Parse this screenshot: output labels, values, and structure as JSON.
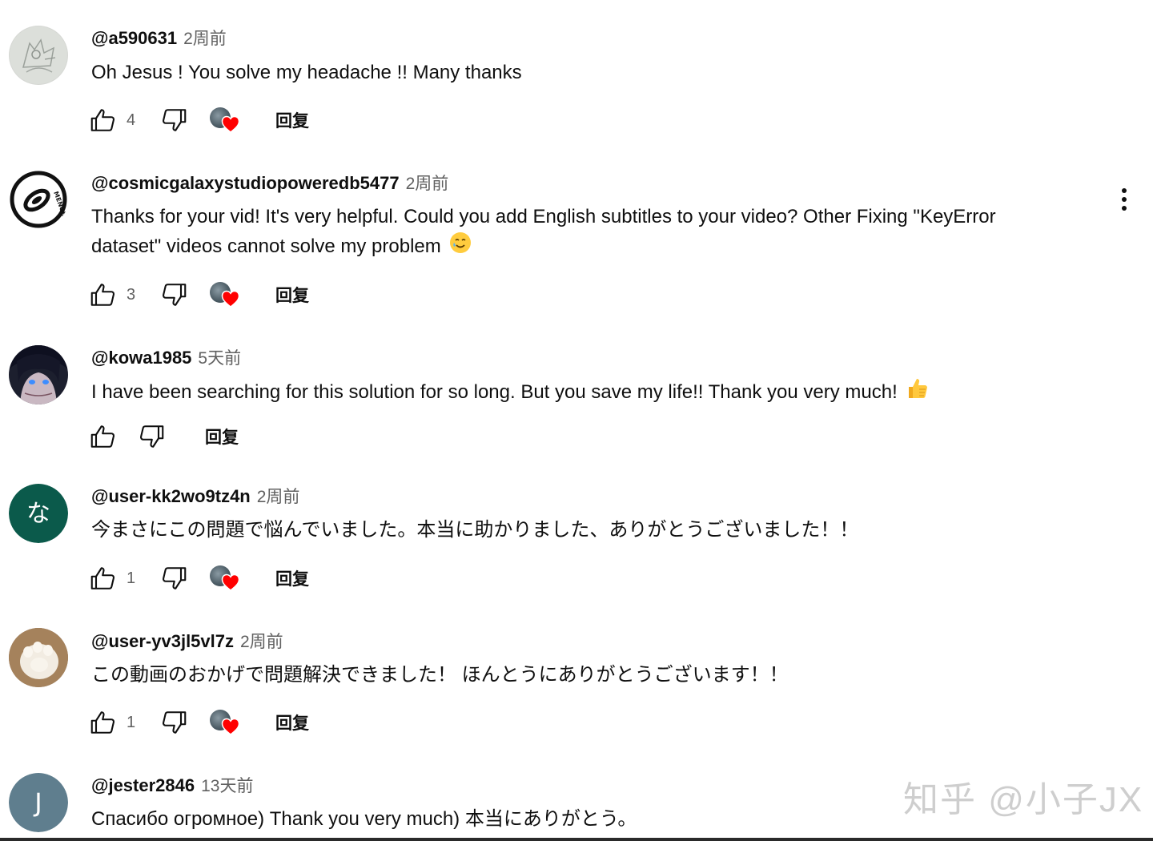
{
  "comments": [
    {
      "author": "@a590631",
      "time": "2周前",
      "text": "Oh Jesus ! You solve my headache !! Many thanks",
      "likes": "4",
      "reply_label": "回复",
      "avatar_icon": "sketch-avatar-icon",
      "creator_heart": true
    },
    {
      "author": "@cosmicgalaxystudiopoweredb5477",
      "time": "2周前",
      "text": "Thanks for your vid! It's very helpful. Could you add English subtitles to your video? Other Fixing \"KeyError dataset\" videos cannot solve my problem",
      "text_emoji": "smiling-face-with-tear-emoji",
      "likes": "3",
      "reply_label": "回复",
      "avatar_icon": "spiral-logo-avatar-icon",
      "avatar_text": "MENGEL KIU",
      "creator_heart": true,
      "has_menu": true
    },
    {
      "author": "@kowa1985",
      "time": "5天前",
      "text": "I have been searching for this solution for so long. But you save my life!! Thank you very much!",
      "text_emoji": "thumbs-up-emoji",
      "likes": "",
      "reply_label": "回复",
      "avatar_icon": "anime-character-avatar-icon",
      "creator_heart": false
    },
    {
      "author": "@user-kk2wo9tz4n",
      "time": "2周前",
      "text": "今まさにこの問題で悩んでいました。本当に助かりました、ありがとうございました！！",
      "likes": "1",
      "reply_label": "回复",
      "avatar_letter": "な",
      "avatar_color": "#0b5a4b",
      "creator_heart": true
    },
    {
      "author": "@user-yv3jl5vl7z",
      "time": "2周前",
      "text": "この動画のおかげで問題解決できました！ ほんとうにありがとうございます！！",
      "likes": "1",
      "reply_label": "回复",
      "avatar_icon": "cat-paw-avatar-icon",
      "creator_heart": true
    },
    {
      "author": "@jester2846",
      "time": "13天前",
      "text": "Спасибо огромное) Thank you very much) 本当にありがとう。",
      "avatar_letter": "J",
      "avatar_color": "#5f7e8e"
    }
  ],
  "watermark": "知乎 @小子JX",
  "colors": {
    "text": "#0f0f0f",
    "secondary": "#606060",
    "heart": "#ff0000"
  }
}
